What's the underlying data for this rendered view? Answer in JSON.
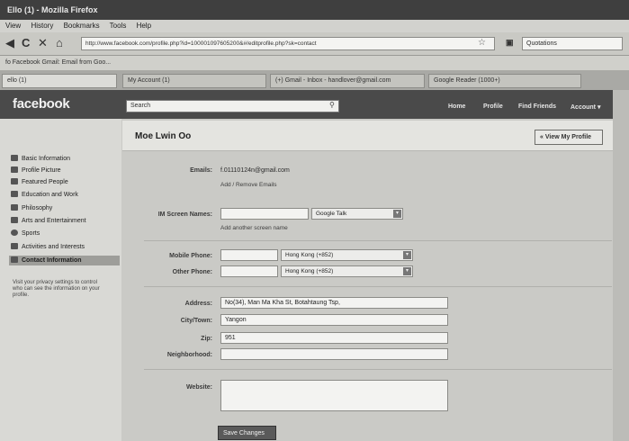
{
  "window": {
    "title": "Ello (1) - Mozilla Firefox"
  },
  "menu": [
    "View",
    "History",
    "Bookmarks",
    "Tools",
    "Help"
  ],
  "nav": {
    "url": "http://www.facebook.com/profile.php?id=100001097605200&#/editprofile.php?sk=contact",
    "search_engine_label": "Quotations"
  },
  "bookmarks": {
    "text": "fo Facebook   Gmail: Email from Goo..."
  },
  "tabs": [
    {
      "label": "ello (1)"
    },
    {
      "label": "My Account (1)"
    },
    {
      "label": "(+) Gmail - Inbox - handlover@gmail.com"
    },
    {
      "label": "Google Reader (1000+)"
    }
  ],
  "fb": {
    "logo": "facebook",
    "search_placeholder": "Search",
    "nav_home": "Home",
    "nav_profile": "Profile",
    "nav_find": "Find Friends",
    "nav_account": "Account ▾"
  },
  "sidebar": {
    "items": [
      {
        "label": "Basic Information",
        "icon": "id-card-icon"
      },
      {
        "label": "Profile Picture",
        "icon": "picture-icon"
      },
      {
        "label": "Featured People",
        "icon": "people-icon"
      },
      {
        "label": "Education and Work",
        "icon": "graduation-icon"
      },
      {
        "label": "Philosophy",
        "icon": "book-icon"
      },
      {
        "label": "Arts and Entertainment",
        "icon": "film-icon"
      },
      {
        "label": "Sports",
        "icon": "ball-icon"
      },
      {
        "label": "Activities and Interests",
        "icon": "pencil-icon"
      },
      {
        "label": "Contact Information",
        "icon": "contact-icon"
      }
    ],
    "help_text": "Visit your privacy settings to control who can see the information on your profile."
  },
  "profile": {
    "name": "Moe Lwin Oo",
    "view_button": "« View My Profile"
  },
  "form": {
    "emails_label": "Emails:",
    "email_value": "f.01110124n@gmail.com",
    "add_remove_emails": "Add / Remove Emails",
    "im_label": "IM Screen Names:",
    "im_value": "",
    "im_service": "Google Talk",
    "add_im": "Add another screen name",
    "mobile_label": "Mobile Phone:",
    "mobile_value": "",
    "mobile_country": "Hong Kong (+852)",
    "other_label": "Other Phone:",
    "other_value": "",
    "other_country": "Hong Kong (+852)",
    "address_label": "Address:",
    "address_value": "No(34), Man Ma Kha St, Botahtaung Tsp,",
    "city_label": "City/Town:",
    "city_value": "Yangon",
    "zip_label": "Zip:",
    "zip_value": "951",
    "neighborhood_label": "Neighborhood:",
    "neighborhood_value": "",
    "website_label": "Website:",
    "website_value": "",
    "save_button": "Save Changes"
  }
}
